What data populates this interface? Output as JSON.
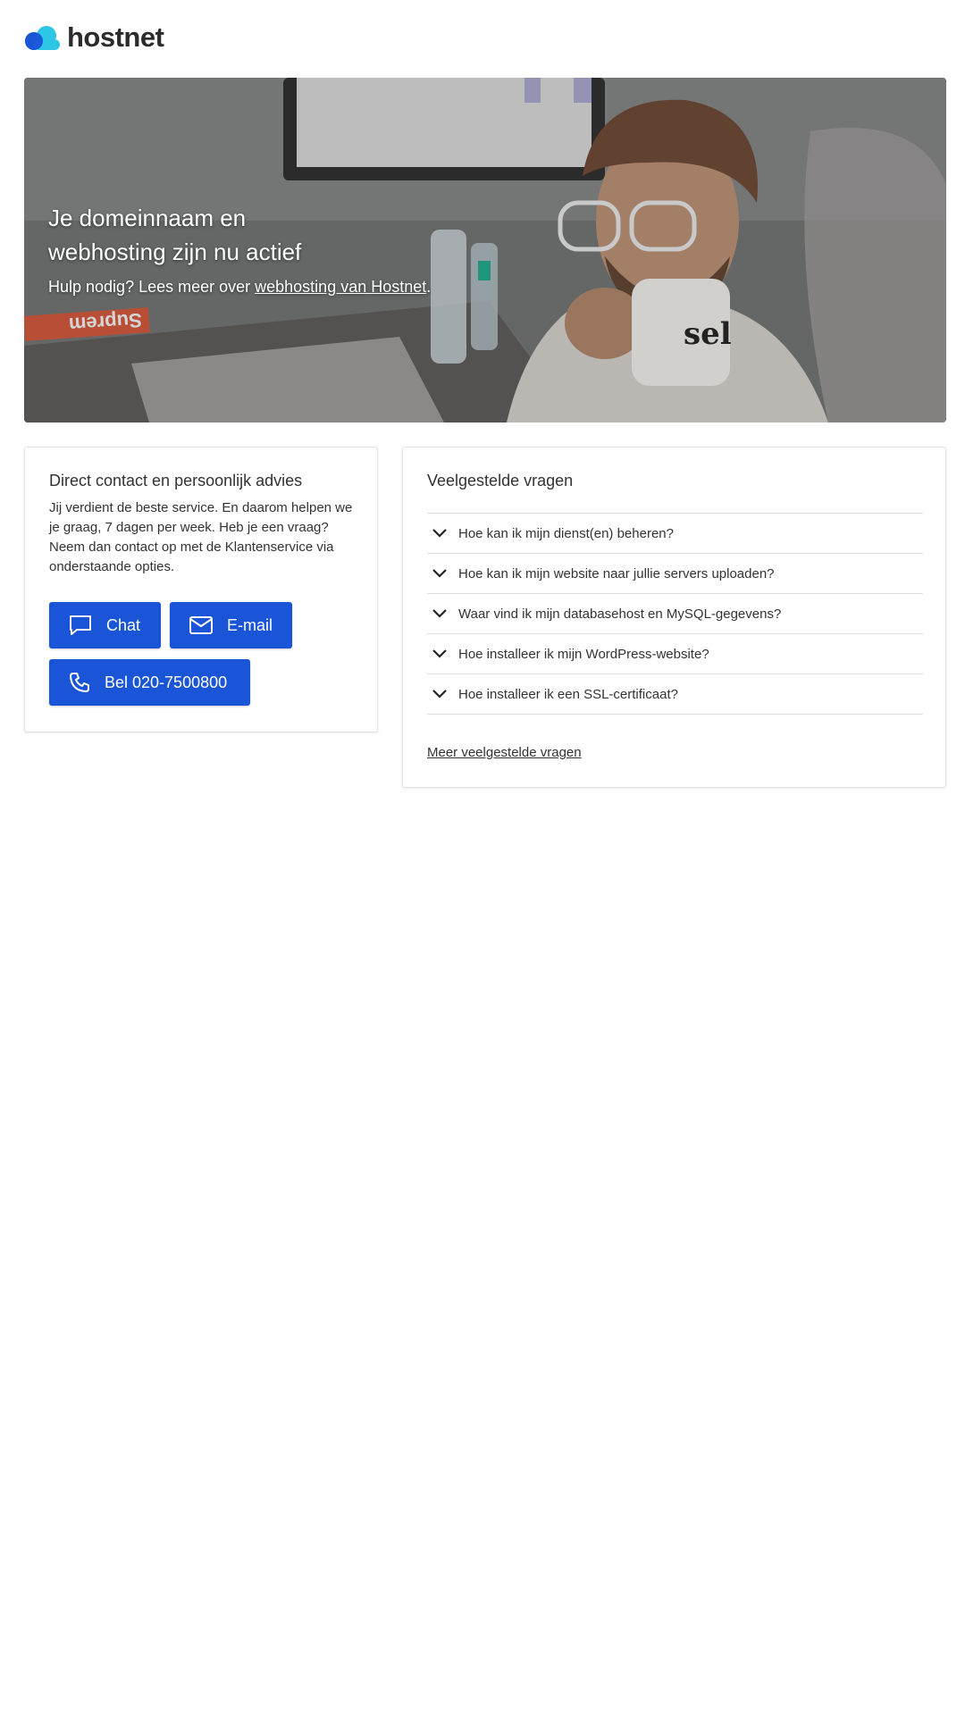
{
  "brand": {
    "name": "hostnet"
  },
  "hero": {
    "title_line1": "Je domeinnaam en",
    "title_line2": "webhosting zijn nu actief",
    "sub_prefix": "Hulp nodig? Lees meer over ",
    "sub_link": "webhosting van Hostnet",
    "sub_suffix": ".",
    "mug_text": "sel",
    "sign_text": "Suprem"
  },
  "contact": {
    "title": "Direct contact en persoonlijk advies",
    "text": "Jij verdient de beste service. En daarom helpen we je graag, 7 dagen per week. Heb je een vraag? Neem dan contact op met de Klantenservice via onderstaande opties.",
    "chat_label": "Chat",
    "email_label": "E-mail",
    "call_label": "Bel 020-7500800"
  },
  "faq": {
    "title": "Veelgestelde vragen",
    "items": [
      "Hoe kan ik mijn dienst(en) beheren?",
      "Hoe kan ik mijn website naar jullie servers uploaden?",
      "Waar vind ik mijn databasehost en MySQL-gegevens?",
      "Hoe installeer ik mijn WordPress-website?",
      "Hoe installeer ik een SSL-certificaat?"
    ],
    "more_label": "Meer veelgestelde vragen"
  },
  "colors": {
    "primary": "#1a55d8",
    "logo_dark": "#1a55d8",
    "logo_light": "#2ec6e6"
  }
}
